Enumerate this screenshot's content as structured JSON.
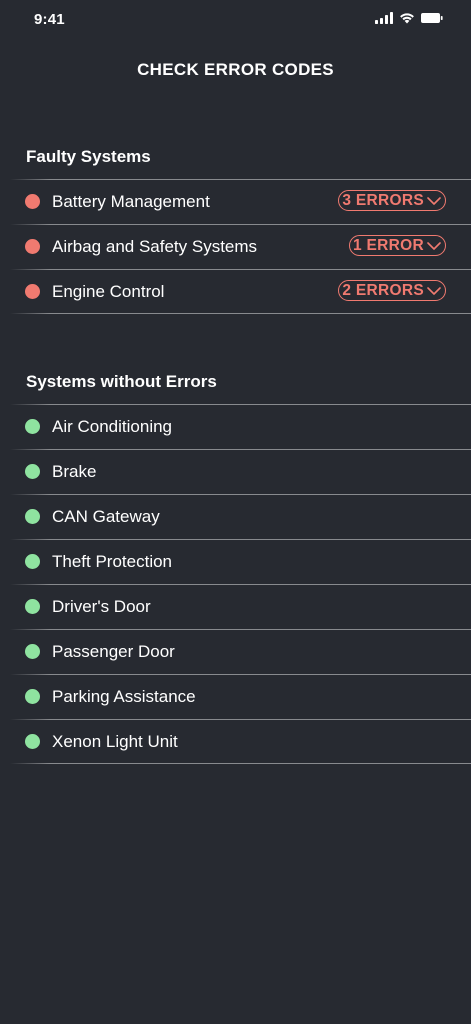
{
  "status_bar": {
    "time": "9:41",
    "icons": [
      "signal-icon",
      "wifi-icon",
      "battery-icon"
    ]
  },
  "header": {
    "title": "CHECK ERROR CODES"
  },
  "faulty_section": {
    "title": "Faulty Systems",
    "status_color": "#f07a70",
    "items": [
      {
        "label": "Battery Management",
        "badge": "3 ERRORS"
      },
      {
        "label": "Airbag and Safety Systems",
        "badge": "1 ERROR"
      },
      {
        "label": "Engine Control",
        "badge": "2 ERRORS"
      }
    ]
  },
  "ok_section": {
    "title": "Systems without Errors",
    "status_color": "#8fe3a0",
    "items": [
      {
        "label": "Air Conditioning"
      },
      {
        "label": "Brake"
      },
      {
        "label": "CAN Gateway"
      },
      {
        "label": "Theft Protection"
      },
      {
        "label": "Driver's Door"
      },
      {
        "label": "Passenger Door"
      },
      {
        "label": "Parking Assistance"
      },
      {
        "label": "Xenon Light Unit"
      }
    ]
  },
  "colors": {
    "background": "#272a31",
    "text": "#ffffff"
  }
}
